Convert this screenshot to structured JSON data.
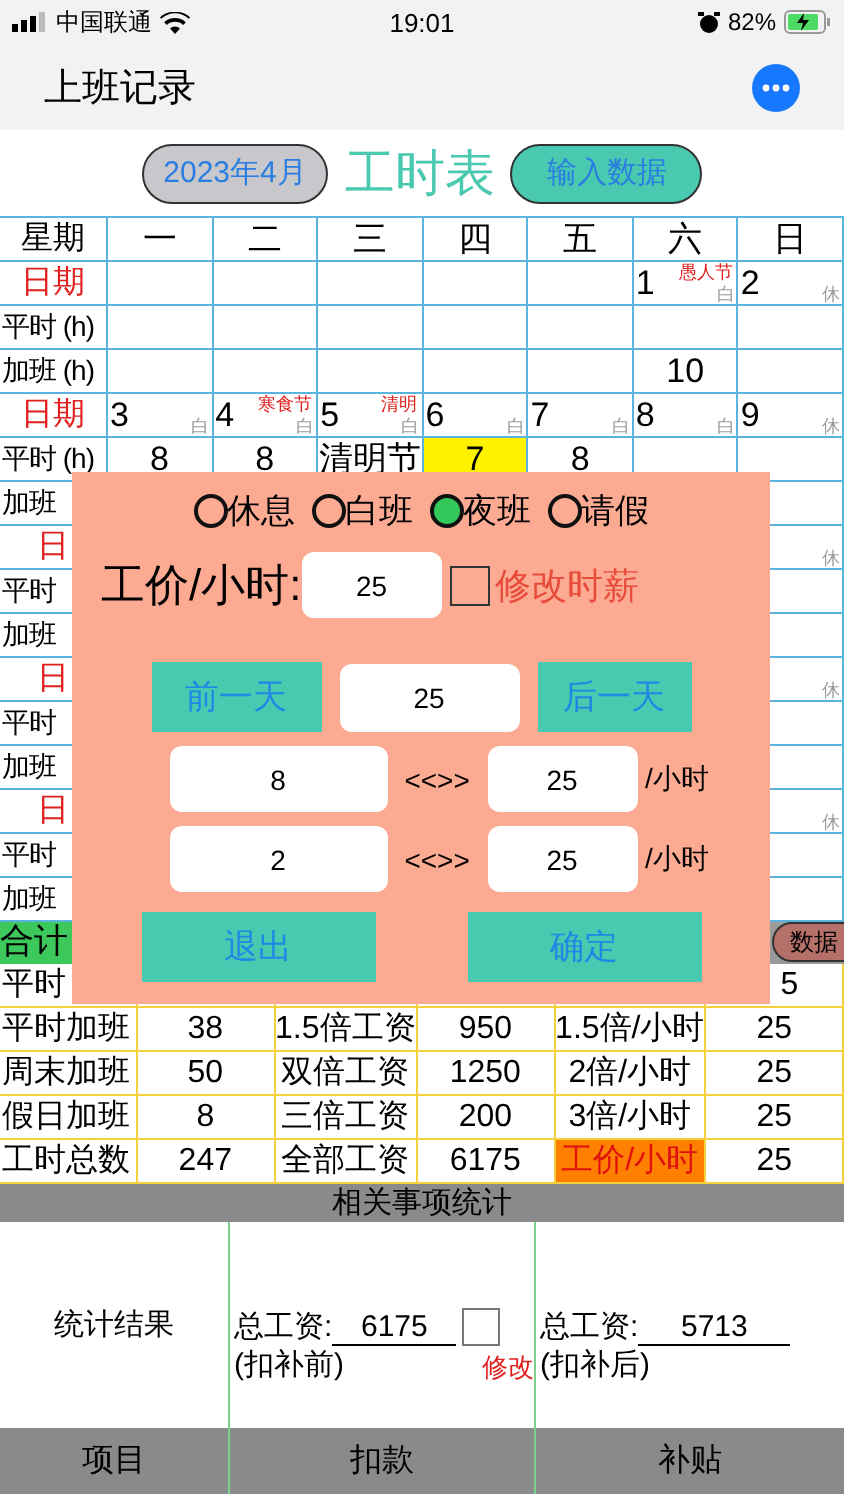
{
  "status_bar": {
    "carrier": "中国联通",
    "time": "19:01",
    "battery": "82%"
  },
  "nav": {
    "title": "上班记录"
  },
  "header": {
    "month_button": "2023年4月",
    "title": "工时表",
    "input_button": "输入数据"
  },
  "calendar": {
    "weekdays": [
      "星期",
      "一",
      "二",
      "三",
      "四",
      "五",
      "六",
      "日"
    ],
    "weeks": [
      {
        "date_label": "日期",
        "days": [
          {
            "kind": "blank"
          },
          {
            "kind": "blank"
          },
          {
            "kind": "blank"
          },
          {
            "kind": "blank"
          },
          {
            "kind": "blank"
          },
          {
            "kind": "date",
            "date": "1",
            "holiday": "愚人节",
            "shift": "白"
          },
          {
            "kind": "date",
            "date": "2",
            "shift": "休"
          }
        ],
        "normal_label": "平时 (h)",
        "normal": [
          {
            "kind": "blank"
          },
          {
            "kind": "blank"
          },
          {
            "kind": "blank"
          },
          {
            "kind": "blank"
          },
          {
            "kind": "blank"
          },
          {
            "kind": "blank"
          },
          {
            "kind": "blank"
          }
        ],
        "overtime_label": "加班 (h)",
        "overtime": [
          {
            "kind": "blank"
          },
          {
            "kind": "blank"
          },
          {
            "kind": "blank"
          },
          {
            "kind": "blank"
          },
          {
            "kind": "blank"
          },
          {
            "kind": "hours",
            "value": "10"
          },
          {
            "kind": "blank"
          }
        ]
      },
      {
        "date_label": "日期",
        "days": [
          {
            "kind": "date",
            "date": "3",
            "shift": "白"
          },
          {
            "kind": "date",
            "date": "4",
            "holiday": "寒食节",
            "shift": "白"
          },
          {
            "kind": "date",
            "date": "5",
            "holiday": "清明",
            "shift": "白"
          },
          {
            "kind": "date",
            "date": "6",
            "shift": "白"
          },
          {
            "kind": "date",
            "date": "7",
            "shift": "白"
          },
          {
            "kind": "date",
            "date": "8",
            "shift": "白"
          },
          {
            "kind": "date",
            "date": "9",
            "shift": "休"
          }
        ],
        "normal_label": "平时 (h)",
        "normal": [
          {
            "kind": "hours",
            "value": "8",
            "highlight": false
          },
          {
            "kind": "hours",
            "value": "8",
            "highlight": false
          },
          {
            "kind": "hours",
            "value": "清明节",
            "highlight": false
          },
          {
            "kind": "hours",
            "value": "7",
            "highlight": true
          },
          {
            "kind": "hours",
            "value": "8",
            "highlight": false
          },
          {
            "kind": "blank"
          },
          {
            "kind": "blank"
          }
        ],
        "overtime_label": "加班",
        "overtime": [
          {
            "kind": "covered"
          },
          {
            "kind": "covered"
          },
          {
            "kind": "covered"
          },
          {
            "kind": "covered"
          },
          {
            "kind": "covered"
          },
          {
            "kind": "covered"
          },
          {
            "kind": "blank"
          }
        ]
      },
      {
        "date_label": "日",
        "days": [
          {
            "kind": "covered"
          },
          {
            "kind": "covered"
          },
          {
            "kind": "covered"
          },
          {
            "kind": "covered"
          },
          {
            "kind": "covered"
          },
          {
            "kind": "covered"
          },
          {
            "kind": "date",
            "shift": "休"
          }
        ],
        "normal_label": "平时",
        "normal": [
          {
            "kind": "covered"
          },
          {
            "kind": "covered"
          },
          {
            "kind": "covered"
          },
          {
            "kind": "covered"
          },
          {
            "kind": "covered"
          },
          {
            "kind": "covered"
          },
          {
            "kind": "blank"
          }
        ],
        "overtime_label": "加班",
        "overtime": [
          {
            "kind": "covered"
          },
          {
            "kind": "covered"
          },
          {
            "kind": "covered"
          },
          {
            "kind": "covered"
          },
          {
            "kind": "covered"
          },
          {
            "kind": "covered"
          },
          {
            "kind": "blank"
          }
        ]
      },
      {
        "date_label": "日",
        "days": [
          {
            "kind": "covered"
          },
          {
            "kind": "covered"
          },
          {
            "kind": "covered"
          },
          {
            "kind": "covered"
          },
          {
            "kind": "covered"
          },
          {
            "kind": "covered"
          },
          {
            "kind": "date",
            "shift": "休"
          }
        ],
        "normal_label": "平时",
        "normal": [
          {
            "kind": "covered"
          },
          {
            "kind": "covered"
          },
          {
            "kind": "covered"
          },
          {
            "kind": "covered"
          },
          {
            "kind": "covered"
          },
          {
            "kind": "covered"
          },
          {
            "kind": "blank"
          }
        ],
        "overtime_label": "加班",
        "overtime": [
          {
            "kind": "covered"
          },
          {
            "kind": "covered"
          },
          {
            "kind": "covered"
          },
          {
            "kind": "covered"
          },
          {
            "kind": "covered"
          },
          {
            "kind": "covered"
          },
          {
            "kind": "blank"
          }
        ]
      },
      {
        "date_label": "日",
        "days": [
          {
            "kind": "covered"
          },
          {
            "kind": "covered"
          },
          {
            "kind": "covered"
          },
          {
            "kind": "covered"
          },
          {
            "kind": "covered"
          },
          {
            "kind": "covered"
          },
          {
            "kind": "date",
            "shift": "休"
          }
        ],
        "normal_label": "平时",
        "normal": [
          {
            "kind": "covered"
          },
          {
            "kind": "covered"
          },
          {
            "kind": "covered"
          },
          {
            "kind": "covered"
          },
          {
            "kind": "covered"
          },
          {
            "kind": "covered"
          },
          {
            "kind": "blank"
          }
        ],
        "overtime_label": "加班",
        "overtime": [
          {
            "kind": "covered"
          },
          {
            "kind": "covered"
          },
          {
            "kind": "covered"
          },
          {
            "kind": "covered"
          },
          {
            "kind": "covered"
          },
          {
            "kind": "covered"
          },
          {
            "kind": "blank"
          }
        ]
      }
    ]
  },
  "summary": {
    "label": "合计",
    "button": "数据",
    "rows": [
      {
        "cells": [
          {
            "kind": "label",
            "text": "平时"
          },
          {
            "kind": "blank"
          },
          {
            "kind": "blank"
          },
          {
            "kind": "blank"
          },
          {
            "kind": "blank"
          },
          {
            "kind": "clipped",
            "text": "5"
          }
        ]
      },
      {
        "cells": [
          {
            "kind": "label",
            "text": "平时加班"
          },
          {
            "kind": "value",
            "text": "38"
          },
          {
            "kind": "value",
            "text": "1.5倍工资"
          },
          {
            "kind": "value",
            "text": "950"
          },
          {
            "kind": "value",
            "text": "1.5倍/小时",
            "highlight": false
          },
          {
            "kind": "value",
            "text": "25"
          }
        ]
      },
      {
        "cells": [
          {
            "kind": "label",
            "text": "周末加班"
          },
          {
            "kind": "value",
            "text": "50"
          },
          {
            "kind": "value",
            "text": "双倍工资"
          },
          {
            "kind": "value",
            "text": "1250"
          },
          {
            "kind": "value",
            "text": "2倍/小时",
            "highlight": false
          },
          {
            "kind": "value",
            "text": "25"
          }
        ]
      },
      {
        "cells": [
          {
            "kind": "label",
            "text": "假日加班"
          },
          {
            "kind": "value",
            "text": "8"
          },
          {
            "kind": "value",
            "text": "三倍工资"
          },
          {
            "kind": "value",
            "text": "200"
          },
          {
            "kind": "value",
            "text": "3倍/小时",
            "highlight": false
          },
          {
            "kind": "value",
            "text": "25"
          }
        ]
      },
      {
        "cells": [
          {
            "kind": "label",
            "text": "工时总数"
          },
          {
            "kind": "value",
            "text": "247"
          },
          {
            "kind": "value",
            "text": "全部工资"
          },
          {
            "kind": "value",
            "text": "6175"
          },
          {
            "kind": "value",
            "text": "工价/小时",
            "highlight": true
          },
          {
            "kind": "value",
            "text": "25"
          }
        ]
      }
    ]
  },
  "stats": {
    "title": "相关事项统计",
    "result_label": "统计结果",
    "before": {
      "label": "总工资:",
      "value": "6175",
      "note": "(扣补前)"
    },
    "edit": {
      "label": "修改",
      "checked": false
    },
    "after": {
      "label": "总工资:",
      "value": "5713",
      "note": "(扣补后)"
    },
    "columns": [
      "项目",
      "扣款",
      "补贴"
    ]
  },
  "dialog": {
    "shift_options": [
      {
        "label": "休息",
        "selected": false
      },
      {
        "label": "白班",
        "selected": false
      },
      {
        "label": "夜班",
        "selected": true
      },
      {
        "label": "请假",
        "selected": false
      }
    ],
    "rate_label": "工价/小时:",
    "rate_value": "25",
    "modify_rate": {
      "label": "修改时薪",
      "checked": false
    },
    "prev_button": "前一天",
    "day_value": "25",
    "next_button": "后一天",
    "hours_rows": [
      {
        "hours": "8",
        "separator": "<<>>",
        "rate": "25",
        "unit": "/小时"
      },
      {
        "hours": "2",
        "separator": "<<>>",
        "rate": "25",
        "unit": "/小时"
      }
    ],
    "buttons": [
      "退出",
      "确定"
    ]
  }
}
